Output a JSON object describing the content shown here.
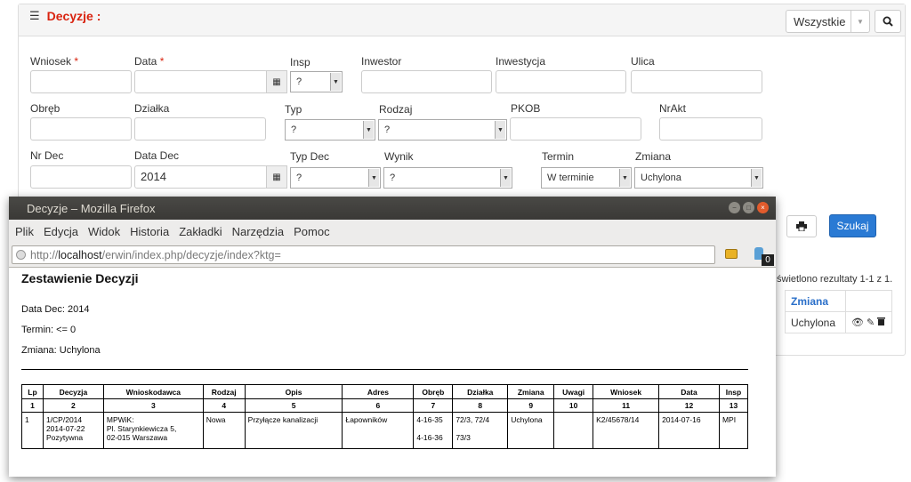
{
  "app": {
    "title": "Decyzje :",
    "dropdown_all": "Wszystkie",
    "search_button": "Szukaj",
    "result_text": "świetlono rezultaty 1-1 z 1.",
    "labels": {
      "wniosek": "Wniosek",
      "data": "Data",
      "insp": "Insp",
      "inwestor": "Inwestor",
      "inwestycja": "Inwestycja",
      "ulica": "Ulica",
      "obreb": "Obręb",
      "dzialka": "Działka",
      "typ": "Typ",
      "rodzaj": "Rodzaj",
      "pkob": "PKOB",
      "nrakt": "NrAkt",
      "nrdec": "Nr Dec",
      "datadec": "Data Dec",
      "typdec": "Typ Dec",
      "wynik": "Wynik",
      "termin": "Termin",
      "zmiana": "Zmiana"
    },
    "required_mark": "*",
    "values": {
      "datadec": "2014",
      "insp": "?",
      "typ": "?",
      "rodzaj": "?",
      "typdec": "?",
      "wynik": "?",
      "termin": "W terminie",
      "zmiana": "Uchylona"
    },
    "results_header": "Zmiana",
    "results_row": "Uchylona"
  },
  "firefox": {
    "window_title": "Decyzje – Mozilla Firefox",
    "menu": [
      "Plik",
      "Edycja",
      "Widok",
      "Historia",
      "Zakładki",
      "Narzędzia",
      "Pomoc"
    ],
    "url_scheme": "http://",
    "url_host": "localhost",
    "url_path": "/erwin/index.php/decyzje/index?ktg=",
    "badge": "0"
  },
  "report": {
    "title": "Zestawienie Decyzji",
    "lines": [
      "Data Dec: 2014",
      "Termin: <= 0",
      "Zmiana: Uchylona"
    ],
    "headers": [
      "Lp",
      "Decyzja",
      "Wnioskodawca",
      "Rodzaj",
      "Opis",
      "Adres",
      "Obręb",
      "Działka",
      "Zmiana",
      "Uwagi",
      "Wniosek",
      "Data",
      "Insp"
    ],
    "numbers": [
      "1",
      "2",
      "3",
      "4",
      "5",
      "6",
      "7",
      "8",
      "9",
      "10",
      "11",
      "12",
      "13"
    ],
    "row": {
      "lp": "1",
      "decyzja": "1/CP/2014\n2014-07-22\nPozytywna",
      "wnioskodawca": "MPWiK:\nPl. Starynkiewicza 5,\n02-015 Warszawa",
      "rodzaj": "Nowa",
      "opis": "Przyłącze kanalizacji",
      "adres": "Łapowników",
      "obreb": "4-16-35\n\n4-16-36",
      "dzialka": "72/3, 72/4\n\n73/3",
      "zmiana": "Uchylona",
      "uwagi": "",
      "wniosek": "K2/45678/14",
      "data": "2014-07-16",
      "insp": "MPI"
    }
  }
}
